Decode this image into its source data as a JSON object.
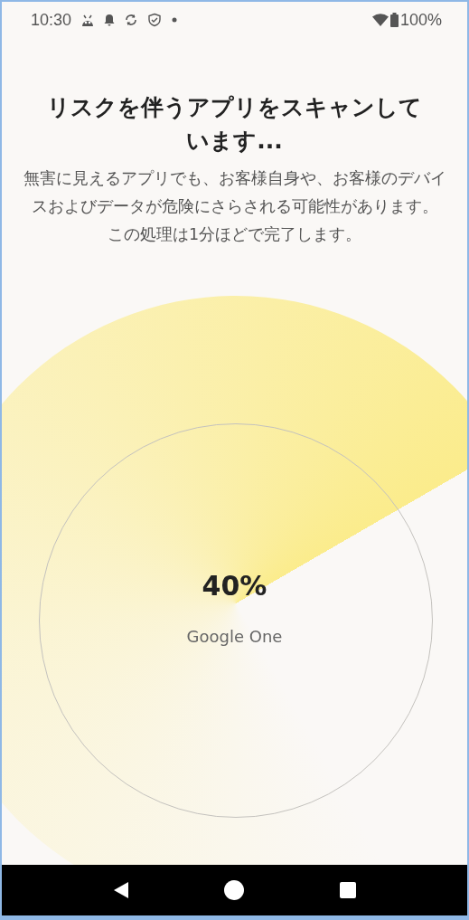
{
  "status_bar": {
    "time": "10:30",
    "battery": "100%"
  },
  "title": "リスクを伴うアプリをスキャンしています...",
  "description": [
    "無害に見えるアプリでも、お客様自身や、お客様のデバイスおよびデータが危険にさらされる可能性があります。",
    "この処理は1分ほどで完了します。"
  ],
  "scan": {
    "percent": "40%",
    "current_app": "Google One"
  }
}
